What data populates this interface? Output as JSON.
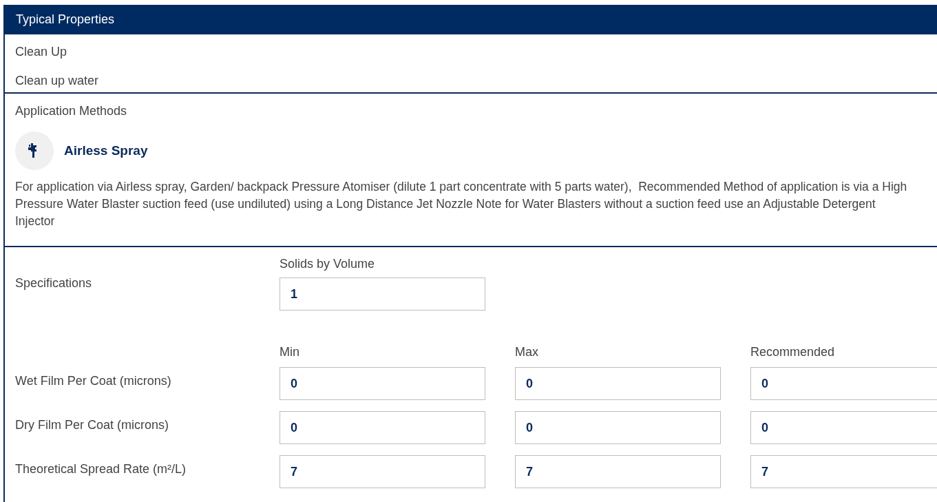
{
  "header": {
    "title": "Typical Properties"
  },
  "clean_up": {
    "label": "Clean Up",
    "value": "Clean up water"
  },
  "application_methods": {
    "label": "Application Methods",
    "methods": [
      {
        "name": "Airless Spray"
      }
    ],
    "description": "For application via Airless spray, Garden/ backpack Pressure Atomiser (dilute 1 part concentrate with 5 parts water),  Recommended Method of application is via a High Pressure Water Blaster suction feed (use undiluted) using a Long Distance Jet Nozzle Note for Water Blasters without a suction feed use an Adjustable Detergent Injector"
  },
  "specifications": {
    "label": "Specifications",
    "solids_by_volume": {
      "label": "Solids by Volume",
      "value": "1"
    },
    "columns": [
      "Min",
      "Max",
      "Recommended"
    ],
    "rows": [
      {
        "label": "Wet Film Per Coat (microns)",
        "values": [
          "0",
          "0",
          "0"
        ]
      },
      {
        "label": "Dry Film Per Coat (microns)",
        "values": [
          "0",
          "0",
          "0"
        ]
      },
      {
        "label": "Theoretical Spread Rate (m²/L)",
        "values": [
          "7",
          "7",
          "7"
        ]
      }
    ]
  }
}
